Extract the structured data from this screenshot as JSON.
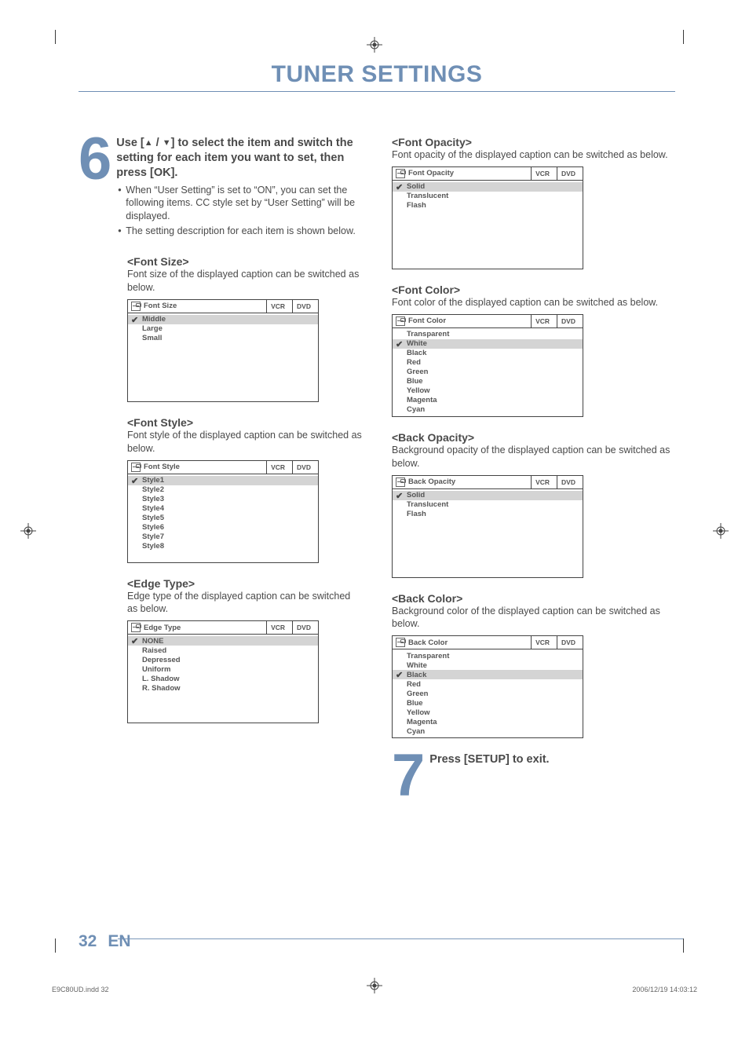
{
  "title": "TUNER SETTINGS",
  "step6": {
    "num": "6",
    "lead_pre": "Use [",
    "lead_up": "▲",
    "lead_slash": " / ",
    "lead_down": "▼",
    "lead_mid": "] to select the item and switch the setting for each item you want to set, then press [OK].",
    "b1": "When “User Setting” is set to “ON”, you can set the following items. CC style set by “User Setting” will be displayed.",
    "b2": "The setting description for each item is shown below."
  },
  "step7": {
    "num": "7",
    "lead": "Press [SETUP] to exit."
  },
  "tabs": {
    "vcr": "VCR",
    "dvd": "DVD"
  },
  "sections": {
    "fontSize": {
      "label": "<Font Size>",
      "desc": "Font size of the displayed caption can be switched as below.",
      "title": "Font Size",
      "items": [
        "Middle",
        "Large",
        "Small"
      ],
      "selected": 0
    },
    "fontStyle": {
      "label": "<Font Style>",
      "desc": "Font style of the displayed caption can be switched as below.",
      "title": "Font Style",
      "items": [
        "Style1",
        "Style2",
        "Style3",
        "Style4",
        "Style5",
        "Style6",
        "Style7",
        "Style8"
      ],
      "selected": 0
    },
    "edgeType": {
      "label": "<Edge Type>",
      "desc": "Edge type of the displayed caption can be switched as below.",
      "title": "Edge Type",
      "items": [
        "NONE",
        "Raised",
        "Depressed",
        "Uniform",
        "L. Shadow",
        "R. Shadow"
      ],
      "selected": 0
    },
    "fontOpacity": {
      "label": "<Font Opacity>",
      "desc": "Font opacity of the displayed caption can be switched as below.",
      "title": "Font Opacity",
      "items": [
        "Solid",
        "Translucent",
        "Flash"
      ],
      "selected": 0
    },
    "fontColor": {
      "label": "<Font Color>",
      "desc": "Font color of the displayed caption can be switched as below.",
      "title": "Font Color",
      "items": [
        "Transparent",
        "White",
        "Black",
        "Red",
        "Green",
        "Blue",
        "Yellow",
        "Magenta",
        "Cyan"
      ],
      "selected": 1
    },
    "backOpacity": {
      "label": "<Back Opacity>",
      "desc": "Background opacity of the displayed caption can be switched as below.",
      "title": "Back Opacity",
      "items": [
        "Solid",
        "Translucent",
        "Flash"
      ],
      "selected": 0
    },
    "backColor": {
      "label": "<Back Color>",
      "desc": "Background color of the displayed caption can be switched as below.",
      "title": "Back Color",
      "items": [
        "Transparent",
        "White",
        "Black",
        "Red",
        "Green",
        "Blue",
        "Yellow",
        "Magenta",
        "Cyan"
      ],
      "selected": 2
    }
  },
  "footer": {
    "page": "32",
    "lang": "EN",
    "file": "E9C80UD.indd   32",
    "ts": "2006/12/19   14:03:12"
  }
}
